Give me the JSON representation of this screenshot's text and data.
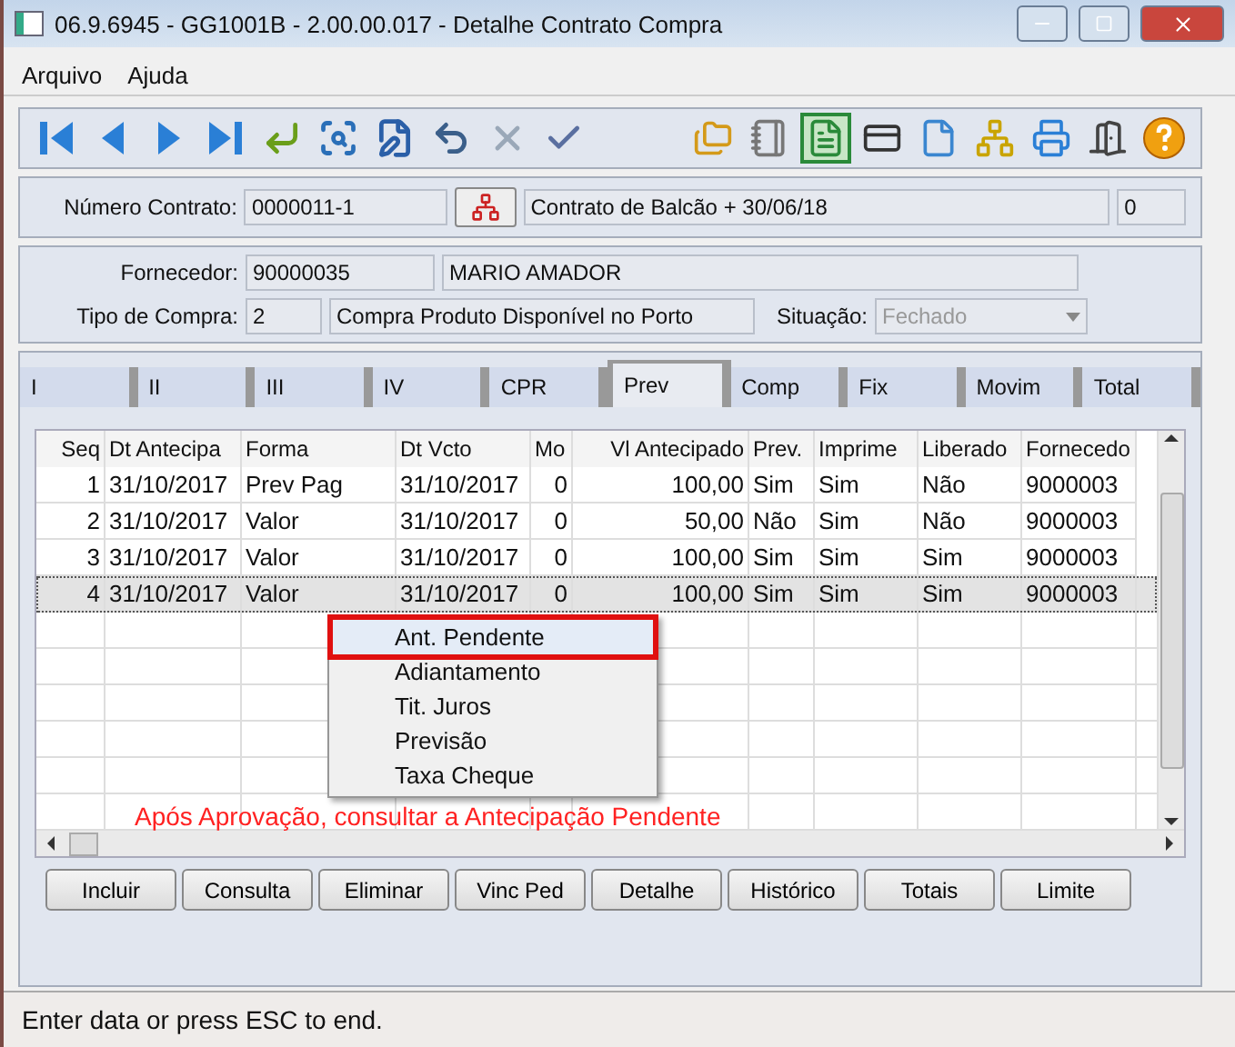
{
  "window": {
    "title": "06.9.6945 - GG1001B - 2.00.00.017 - Detalhe Contrato Compra"
  },
  "menu": [
    {
      "label": "Arquivo"
    },
    {
      "label": "Ajuda"
    }
  ],
  "toolbar": {
    "left": [
      {
        "kind": "first"
      },
      {
        "kind": "prev"
      },
      {
        "kind": "next"
      },
      {
        "kind": "last"
      },
      {
        "kind": "enter"
      },
      {
        "kind": "zoom"
      },
      {
        "kind": "edit"
      },
      {
        "kind": "undo"
      },
      {
        "kind": "cancel"
      },
      {
        "kind": "confirm"
      }
    ],
    "right": [
      {
        "kind": "folders",
        "selected": false
      },
      {
        "kind": "notepad",
        "selected": false
      },
      {
        "kind": "document",
        "selected": true
      },
      {
        "kind": "form",
        "selected": false
      },
      {
        "kind": "page",
        "selected": false
      },
      {
        "kind": "tree",
        "selected": false
      },
      {
        "kind": "printer",
        "selected": false
      },
      {
        "kind": "exit",
        "selected": false
      },
      {
        "kind": "help",
        "selected": false
      }
    ]
  },
  "contract": {
    "label": "Número Contrato:",
    "number": "0000011-1",
    "description": "Contrato de Balcão + 30/06/18",
    "extra": "0"
  },
  "supplier": {
    "label": "Fornecedor:",
    "code": "90000035",
    "name": "MARIO AMADOR",
    "purchase_type_label": "Tipo de Compra:",
    "purchase_type_code": "2",
    "purchase_type": "Compra Produto Disponível no Porto",
    "status_label": "Situação:",
    "status": "Fechado",
    "status_disabled": true
  },
  "tabs": [
    {
      "label": "I",
      "selected": false
    },
    {
      "label": "II",
      "selected": false
    },
    {
      "label": "III",
      "selected": false
    },
    {
      "label": "IV",
      "selected": false
    },
    {
      "label": "CPR",
      "selected": false
    },
    {
      "label": "Prev",
      "selected": true
    },
    {
      "label": "Comp",
      "selected": false
    },
    {
      "label": "Fix",
      "selected": false
    },
    {
      "label": "Movim",
      "selected": false
    },
    {
      "label": "Total",
      "selected": false
    }
  ],
  "table": {
    "columns": [
      "Seq",
      "Dt Antecipa",
      "Forma",
      "Dt Vcto",
      "Mo",
      "Vl Antecipado",
      "Prev.",
      "Imprime",
      "Liberado",
      "Fornecedo"
    ],
    "rows": [
      {
        "cells": [
          "1",
          "31/10/2017",
          "Prev Pag",
          "31/10/2017",
          "0",
          "100,00",
          "Sim",
          "Sim",
          "Não",
          "9000003"
        ],
        "selected": false
      },
      {
        "cells": [
          "2",
          "31/10/2017",
          "Valor",
          "31/10/2017",
          "0",
          "50,00",
          "Não",
          "Sim",
          "Não",
          "9000003"
        ],
        "selected": false
      },
      {
        "cells": [
          "3",
          "31/10/2017",
          "Valor",
          "31/10/2017",
          "0",
          "100,00",
          "Sim",
          "Sim",
          "Sim",
          "9000003"
        ],
        "selected": false
      },
      {
        "cells": [
          "4",
          "31/10/2017",
          "Valor",
          "31/10/2017",
          "0",
          "100,00",
          "Sim",
          "Sim",
          "Sim",
          "9000003"
        ],
        "selected": true
      }
    ]
  },
  "context_menu": [
    {
      "label": "Ant. Pendente",
      "selected": true
    },
    {
      "label": "Adiantamento",
      "selected": false
    },
    {
      "label": "Tit. Juros",
      "selected": false
    },
    {
      "label": "Previsão",
      "selected": false
    },
    {
      "label": "Taxa Cheque",
      "selected": false
    }
  ],
  "annotation": "Após Aprovação, consultar a Antecipação Pendente",
  "buttons": [
    "Incluir",
    "Consulta",
    "Eliminar",
    "Vinc Ped",
    "Detalhe",
    "Histórico",
    "Totais",
    "Limite"
  ],
  "status_bar": "Enter data or press ESC to end."
}
